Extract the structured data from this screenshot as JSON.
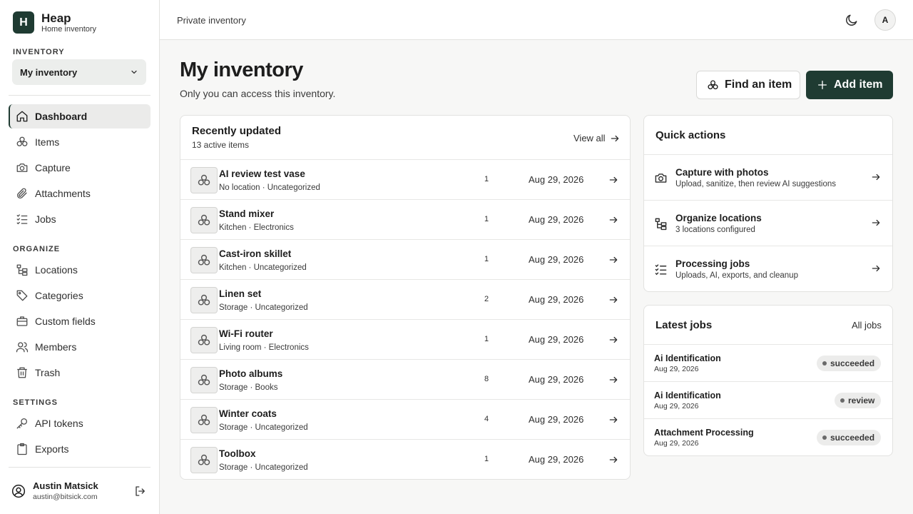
{
  "brand": {
    "initial": "H",
    "name": "Heap",
    "subtitle": "Home inventory"
  },
  "sidebar": {
    "inventory_label": "INVENTORY",
    "inventory_selected": "My inventory",
    "main_items": [
      {
        "label": "Dashboard",
        "icon": "home-icon",
        "active": true
      },
      {
        "label": "Items",
        "icon": "items-icon"
      },
      {
        "label": "Capture",
        "icon": "camera-icon"
      },
      {
        "label": "Attachments",
        "icon": "paperclip-icon"
      },
      {
        "label": "Jobs",
        "icon": "list-check-icon"
      }
    ],
    "organize_label": "ORGANIZE",
    "organize_items": [
      {
        "label": "Locations",
        "icon": "locations-icon"
      },
      {
        "label": "Categories",
        "icon": "tag-icon"
      },
      {
        "label": "Custom fields",
        "icon": "briefcase-icon"
      },
      {
        "label": "Members",
        "icon": "users-icon"
      },
      {
        "label": "Trash",
        "icon": "trash-icon"
      }
    ],
    "settings_label": "SETTINGS",
    "settings_items": [
      {
        "label": "API tokens",
        "icon": "key-icon"
      },
      {
        "label": "Exports",
        "icon": "clipboard-icon"
      }
    ],
    "user": {
      "name": "Austin Matsick",
      "email": "austin@bitsick.com"
    }
  },
  "topbar": {
    "breadcrumb": "Private inventory",
    "avatar_initial": "A"
  },
  "header": {
    "title": "My inventory",
    "subtitle": "Only you can access this inventory.",
    "find_label": "Find an item",
    "add_label": "Add item"
  },
  "recent": {
    "title": "Recently updated",
    "subtitle": "13 active items",
    "view_all": "View all",
    "items": [
      {
        "name": "AI review test vase",
        "meta": "No location · Uncategorized",
        "qty": "1",
        "date": "Aug 29, 2026"
      },
      {
        "name": "Stand mixer",
        "meta": "Kitchen · Electronics",
        "qty": "1",
        "date": "Aug 29, 2026"
      },
      {
        "name": "Cast-iron skillet",
        "meta": "Kitchen · Uncategorized",
        "qty": "1",
        "date": "Aug 29, 2026"
      },
      {
        "name": "Linen set",
        "meta": "Storage · Uncategorized",
        "qty": "2",
        "date": "Aug 29, 2026"
      },
      {
        "name": "Wi-Fi router",
        "meta": "Living room · Electronics",
        "qty": "1",
        "date": "Aug 29, 2026"
      },
      {
        "name": "Photo albums",
        "meta": "Storage · Books",
        "qty": "8",
        "date": "Aug 29, 2026"
      },
      {
        "name": "Winter coats",
        "meta": "Storage · Uncategorized",
        "qty": "4",
        "date": "Aug 29, 2026"
      },
      {
        "name": "Toolbox",
        "meta": "Storage · Uncategorized",
        "qty": "1",
        "date": "Aug 29, 2026"
      }
    ]
  },
  "quick_actions": {
    "title": "Quick actions",
    "items": [
      {
        "title": "Capture with photos",
        "subtitle": "Upload, sanitize, then review AI suggestions",
        "icon": "camera-icon"
      },
      {
        "title": "Organize locations",
        "subtitle": "3 locations configured",
        "icon": "locations-icon"
      },
      {
        "title": "Processing jobs",
        "subtitle": "Uploads, AI, exports, and cleanup",
        "icon": "list-check-icon"
      }
    ]
  },
  "latest_jobs": {
    "title": "Latest jobs",
    "all_jobs": "All jobs",
    "items": [
      {
        "name": "Ai Identification",
        "date": "Aug 29, 2026",
        "status": "succeeded"
      },
      {
        "name": "Ai Identification",
        "date": "Aug 29, 2026",
        "status": "review"
      },
      {
        "name": "Attachment Processing",
        "date": "Aug 29, 2026",
        "status": "succeeded"
      }
    ]
  }
}
